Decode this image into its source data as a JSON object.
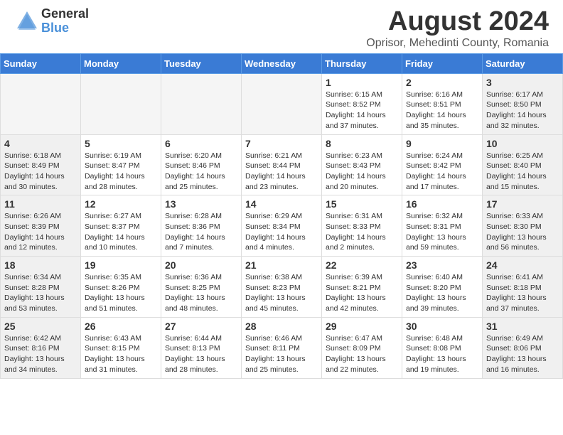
{
  "header": {
    "logo_general": "General",
    "logo_blue": "Blue",
    "month_year": "August 2024",
    "location": "Oprisor, Mehedinti County, Romania"
  },
  "days_of_week": [
    "Sunday",
    "Monday",
    "Tuesday",
    "Wednesday",
    "Thursday",
    "Friday",
    "Saturday"
  ],
  "weeks": [
    [
      {
        "day": "",
        "empty": true
      },
      {
        "day": "",
        "empty": true
      },
      {
        "day": "",
        "empty": true
      },
      {
        "day": "",
        "empty": true
      },
      {
        "day": "1",
        "sunrise": "6:15 AM",
        "sunset": "8:52 PM",
        "daylight": "14 hours and 37 minutes."
      },
      {
        "day": "2",
        "sunrise": "6:16 AM",
        "sunset": "8:51 PM",
        "daylight": "14 hours and 35 minutes."
      },
      {
        "day": "3",
        "sunrise": "6:17 AM",
        "sunset": "8:50 PM",
        "daylight": "14 hours and 32 minutes."
      }
    ],
    [
      {
        "day": "4",
        "sunrise": "6:18 AM",
        "sunset": "8:49 PM",
        "daylight": "14 hours and 30 minutes."
      },
      {
        "day": "5",
        "sunrise": "6:19 AM",
        "sunset": "8:47 PM",
        "daylight": "14 hours and 28 minutes."
      },
      {
        "day": "6",
        "sunrise": "6:20 AM",
        "sunset": "8:46 PM",
        "daylight": "14 hours and 25 minutes."
      },
      {
        "day": "7",
        "sunrise": "6:21 AM",
        "sunset": "8:44 PM",
        "daylight": "14 hours and 23 minutes."
      },
      {
        "day": "8",
        "sunrise": "6:23 AM",
        "sunset": "8:43 PM",
        "daylight": "14 hours and 20 minutes."
      },
      {
        "day": "9",
        "sunrise": "6:24 AM",
        "sunset": "8:42 PM",
        "daylight": "14 hours and 17 minutes."
      },
      {
        "day": "10",
        "sunrise": "6:25 AM",
        "sunset": "8:40 PM",
        "daylight": "14 hours and 15 minutes."
      }
    ],
    [
      {
        "day": "11",
        "sunrise": "6:26 AM",
        "sunset": "8:39 PM",
        "daylight": "14 hours and 12 minutes."
      },
      {
        "day": "12",
        "sunrise": "6:27 AM",
        "sunset": "8:37 PM",
        "daylight": "14 hours and 10 minutes."
      },
      {
        "day": "13",
        "sunrise": "6:28 AM",
        "sunset": "8:36 PM",
        "daylight": "14 hours and 7 minutes."
      },
      {
        "day": "14",
        "sunrise": "6:29 AM",
        "sunset": "8:34 PM",
        "daylight": "14 hours and 4 minutes."
      },
      {
        "day": "15",
        "sunrise": "6:31 AM",
        "sunset": "8:33 PM",
        "daylight": "14 hours and 2 minutes."
      },
      {
        "day": "16",
        "sunrise": "6:32 AM",
        "sunset": "8:31 PM",
        "daylight": "13 hours and 59 minutes."
      },
      {
        "day": "17",
        "sunrise": "6:33 AM",
        "sunset": "8:30 PM",
        "daylight": "13 hours and 56 minutes."
      }
    ],
    [
      {
        "day": "18",
        "sunrise": "6:34 AM",
        "sunset": "8:28 PM",
        "daylight": "13 hours and 53 minutes."
      },
      {
        "day": "19",
        "sunrise": "6:35 AM",
        "sunset": "8:26 PM",
        "daylight": "13 hours and 51 minutes."
      },
      {
        "day": "20",
        "sunrise": "6:36 AM",
        "sunset": "8:25 PM",
        "daylight": "13 hours and 48 minutes."
      },
      {
        "day": "21",
        "sunrise": "6:38 AM",
        "sunset": "8:23 PM",
        "daylight": "13 hours and 45 minutes."
      },
      {
        "day": "22",
        "sunrise": "6:39 AM",
        "sunset": "8:21 PM",
        "daylight": "13 hours and 42 minutes."
      },
      {
        "day": "23",
        "sunrise": "6:40 AM",
        "sunset": "8:20 PM",
        "daylight": "13 hours and 39 minutes."
      },
      {
        "day": "24",
        "sunrise": "6:41 AM",
        "sunset": "8:18 PM",
        "daylight": "13 hours and 37 minutes."
      }
    ],
    [
      {
        "day": "25",
        "sunrise": "6:42 AM",
        "sunset": "8:16 PM",
        "daylight": "13 hours and 34 minutes."
      },
      {
        "day": "26",
        "sunrise": "6:43 AM",
        "sunset": "8:15 PM",
        "daylight": "13 hours and 31 minutes."
      },
      {
        "day": "27",
        "sunrise": "6:44 AM",
        "sunset": "8:13 PM",
        "daylight": "13 hours and 28 minutes."
      },
      {
        "day": "28",
        "sunrise": "6:46 AM",
        "sunset": "8:11 PM",
        "daylight": "13 hours and 25 minutes."
      },
      {
        "day": "29",
        "sunrise": "6:47 AM",
        "sunset": "8:09 PM",
        "daylight": "13 hours and 22 minutes."
      },
      {
        "day": "30",
        "sunrise": "6:48 AM",
        "sunset": "8:08 PM",
        "daylight": "13 hours and 19 minutes."
      },
      {
        "day": "31",
        "sunrise": "6:49 AM",
        "sunset": "8:06 PM",
        "daylight": "13 hours and 16 minutes."
      }
    ]
  ],
  "labels": {
    "sunrise": "Sunrise:",
    "sunset": "Sunset:",
    "daylight": "Daylight:"
  }
}
